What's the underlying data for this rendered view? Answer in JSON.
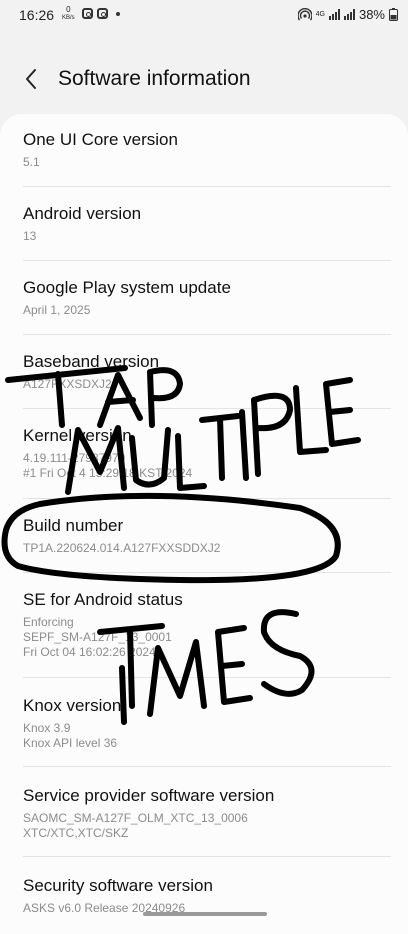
{
  "status_bar": {
    "time": "16:26",
    "netspeed_value": "0",
    "netspeed_unit": "KB/s",
    "signal_label": "4G",
    "battery": "38%"
  },
  "header": {
    "title": "Software information"
  },
  "items": [
    {
      "label": "One UI Core version",
      "value": "5.1"
    },
    {
      "label": "Android version",
      "value": "13"
    },
    {
      "label": "Google Play system update",
      "value": "April 1, 2025"
    },
    {
      "label": "Baseband version",
      "value": "A127FXXSDXJ2"
    },
    {
      "label": "Kernel version",
      "value": "4.19.111-27987979",
      "value2": "#1 Fri Oct 4 15:29:18 KST 2024"
    },
    {
      "label": "Build number",
      "value": "TP1A.220624.014.A127FXXSDDXJ2"
    },
    {
      "label": "SE for Android status",
      "value": "Enforcing",
      "value2": "SEPF_SM-A127F_13_0001",
      "value3": "Fri Oct 04 16:02:26 2024"
    },
    {
      "label": "Knox version",
      "value": "Knox 3.9",
      "value2": "Knox API level 36"
    },
    {
      "label": "Service provider software version",
      "value": "SAOMC_SM-A127F_OLM_XTC_13_0006",
      "value2": "XTC/XTC,XTC/SKZ"
    },
    {
      "label": "Security software version",
      "value": "ASKS v6.0 Release 20240926"
    }
  ],
  "annotation": {
    "words": [
      "TAP",
      "MULTIPLE",
      "TIMES"
    ],
    "color": "#000000"
  }
}
